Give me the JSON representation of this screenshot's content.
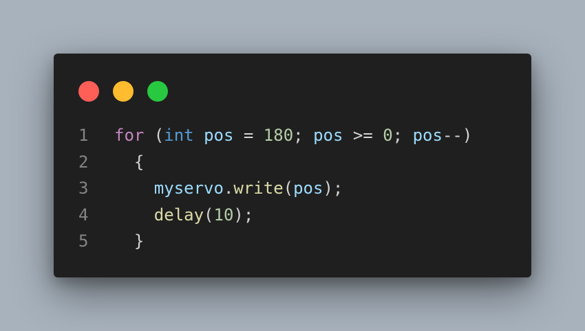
{
  "colors": {
    "background": "#a8b2bd",
    "window": "#1f1f1f",
    "close": "#ff5f57",
    "minimize": "#febc2e",
    "maximize": "#28c840",
    "keyword": "#c586c0",
    "type": "#569cd6",
    "variable": "#9cdcfe",
    "number": "#b5cea8",
    "function": "#dcdcaa",
    "plain": "#d4d4d4",
    "line_number": "#858585"
  },
  "window_controls": [
    "close-dot",
    "minimize-dot",
    "maximize-dot"
  ],
  "code": {
    "lines": [
      {
        "number": "1",
        "tokens": [
          {
            "text": "for",
            "kind": "keyword"
          },
          {
            "text": " (",
            "kind": "plain"
          },
          {
            "text": "int",
            "kind": "type"
          },
          {
            "text": " ",
            "kind": "plain"
          },
          {
            "text": "pos",
            "kind": "variable"
          },
          {
            "text": " = ",
            "kind": "plain"
          },
          {
            "text": "180",
            "kind": "number"
          },
          {
            "text": "; ",
            "kind": "plain"
          },
          {
            "text": "pos",
            "kind": "variable"
          },
          {
            "text": " >= ",
            "kind": "plain"
          },
          {
            "text": "0",
            "kind": "number"
          },
          {
            "text": "; ",
            "kind": "plain"
          },
          {
            "text": "pos",
            "kind": "variable"
          },
          {
            "text": "--)",
            "kind": "plain"
          }
        ]
      },
      {
        "number": "2",
        "tokens": [
          {
            "text": "  {",
            "kind": "plain"
          }
        ]
      },
      {
        "number": "3",
        "tokens": [
          {
            "text": "    ",
            "kind": "plain"
          },
          {
            "text": "myservo",
            "kind": "variable"
          },
          {
            "text": ".",
            "kind": "plain"
          },
          {
            "text": "write",
            "kind": "function"
          },
          {
            "text": "(",
            "kind": "plain"
          },
          {
            "text": "pos",
            "kind": "variable"
          },
          {
            "text": ");",
            "kind": "plain"
          }
        ]
      },
      {
        "number": "4",
        "tokens": [
          {
            "text": "    ",
            "kind": "plain"
          },
          {
            "text": "delay",
            "kind": "function"
          },
          {
            "text": "(",
            "kind": "plain"
          },
          {
            "text": "10",
            "kind": "number"
          },
          {
            "text": ");",
            "kind": "plain"
          }
        ]
      },
      {
        "number": "5",
        "tokens": [
          {
            "text": "  }",
            "kind": "plain"
          }
        ]
      }
    ]
  }
}
